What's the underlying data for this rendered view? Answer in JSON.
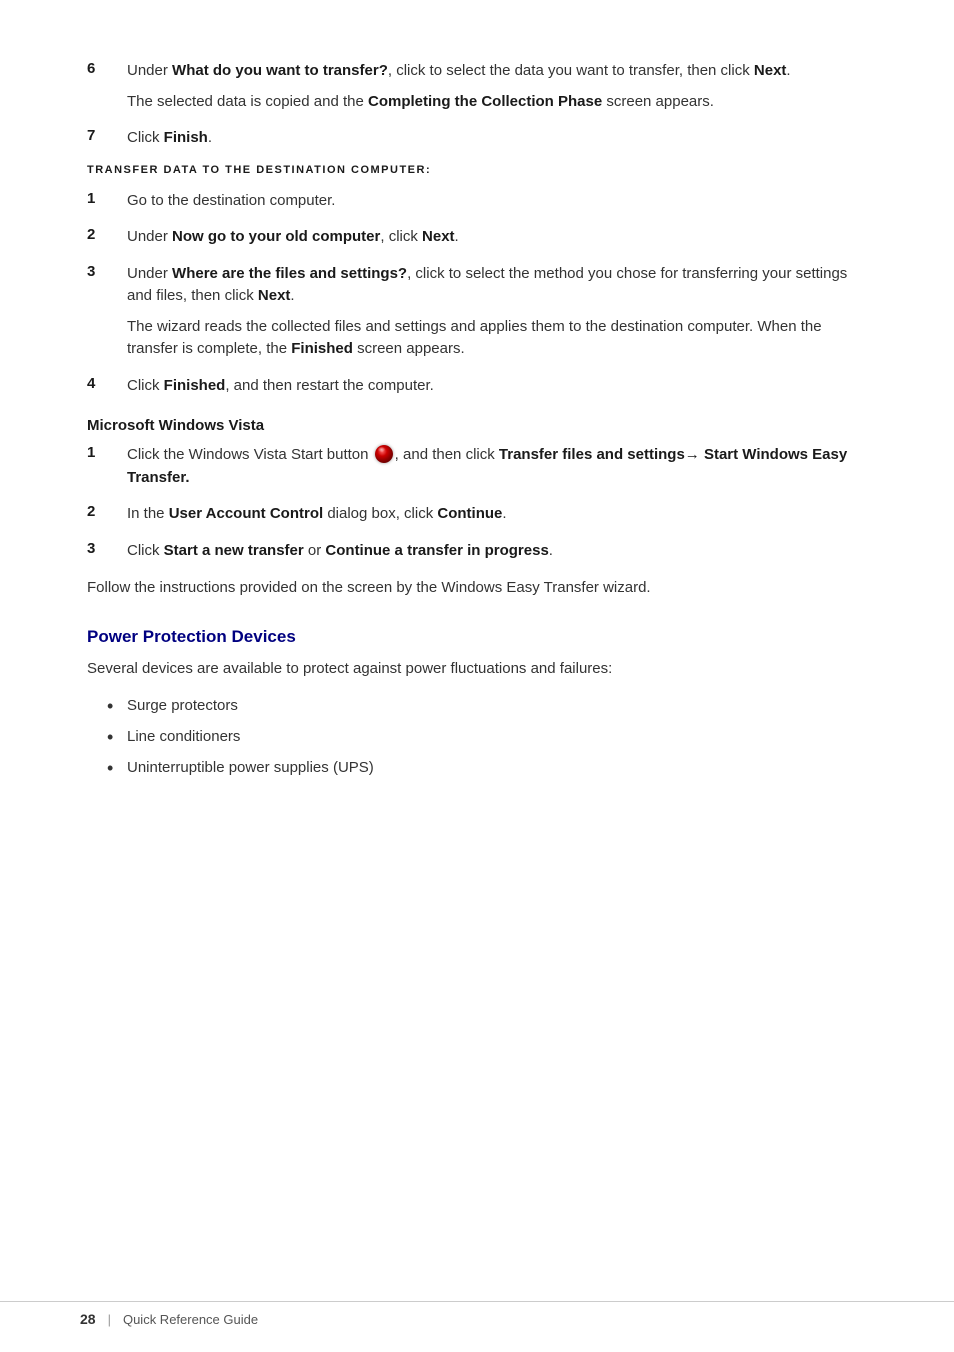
{
  "page": {
    "number": "28",
    "footer_separator": "|",
    "footer_guide": "Quick Reference Guide"
  },
  "content": {
    "step6_number": "6",
    "step6_text_pre": "Under ",
    "step6_bold1": "What do you want to transfer?",
    "step6_text_mid": ", click to select the data you want to transfer, then click ",
    "step6_bold2": "Next",
    "step6_text_end": ".",
    "step6_sub": "The selected data is copied and the ",
    "step6_sub_bold": "Completing the Collection Phase",
    "step6_sub_end": " screen appears.",
    "step7_number": "7",
    "step7_text_pre": "Click ",
    "step7_bold": "Finish",
    "step7_text_end": ".",
    "transfer_heading": "TRANSFER DATA TO THE DESTINATION COMPUTER:",
    "t1_number": "1",
    "t1_text": "Go to the destination computer.",
    "t2_number": "2",
    "t2_text_pre": "Under ",
    "t2_bold1": "Now go to your old computer",
    "t2_text_mid": ", click ",
    "t2_bold2": "Next",
    "t2_text_end": ".",
    "t3_number": "3",
    "t3_text_pre": "Under ",
    "t3_bold1": "Where are the files and settings?",
    "t3_text_mid": ", click to select the method you chose for transferring your settings and files, then click ",
    "t3_bold2": "Next",
    "t3_text_end": ".",
    "t3_sub": "The wizard reads the collected files and settings and applies them to the destination computer. When the transfer is complete, the ",
    "t3_sub_bold": "Finished",
    "t3_sub_end": " screen appears.",
    "t4_number": "4",
    "t4_text_pre": "Click ",
    "t4_bold1": "Finished",
    "t4_text_mid": ", and then restart the computer.",
    "vista_heading": "Microsoft Windows Vista",
    "v1_number": "1",
    "v1_text_pre": "Click the Windows Vista Start button",
    "v1_text_mid": ", and then click ",
    "v1_bold1": "Transfer files and settings",
    "v1_arrow": "→",
    "v1_bold2": " Start Windows Easy Transfer.",
    "v2_number": "2",
    "v2_text_pre": "In the ",
    "v2_bold1": "User Account Control",
    "v2_text_mid": " dialog box, click ",
    "v2_bold2": "Continue",
    "v2_text_end": ".",
    "v3_number": "3",
    "v3_text_pre": "Click ",
    "v3_bold1": "Start a new transfer",
    "v3_text_mid": " or ",
    "v3_bold2": "Continue a transfer in progress",
    "v3_text_end": ".",
    "follow_text": "Follow the instructions provided on the screen by the Windows Easy Transfer wizard.",
    "power_heading": "Power Protection Devices",
    "power_intro": "Several devices are available to protect against power fluctuations and failures:",
    "bullets": [
      "Surge protectors",
      "Line conditioners",
      "Uninterruptible power supplies (UPS)"
    ]
  }
}
